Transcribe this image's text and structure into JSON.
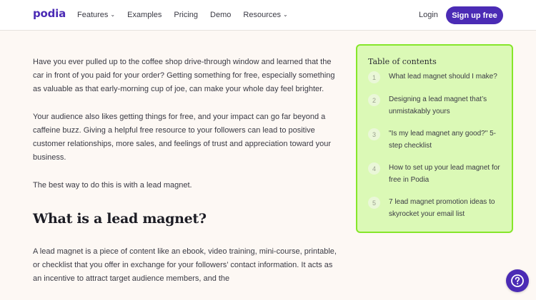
{
  "nav": {
    "logo": "podia",
    "links": [
      {
        "label": "Features",
        "dropdown": true
      },
      {
        "label": "Examples",
        "dropdown": false
      },
      {
        "label": "Pricing",
        "dropdown": false
      },
      {
        "label": "Demo",
        "dropdown": false
      },
      {
        "label": "Resources",
        "dropdown": true
      }
    ],
    "login": "Login",
    "signup": "Sign up free"
  },
  "article": {
    "paragraphs": [
      "Have you ever pulled up to the coffee shop drive-through window and learned that the car in front of you paid for your order? Getting something for free, especially something as valuable as that early-morning cup of joe, can make your whole day feel brighter.",
      "Your audience also likes getting things for free, and your impact can go far beyond a caffeine buzz. Giving a helpful free resource to your followers can lead to positive customer relationships, more sales, and feelings of trust and appreciation toward your business.",
      "The best way to do this is with a lead magnet."
    ],
    "heading": "What is a lead magnet?",
    "paragraph_after": "A lead magnet is a piece of content like an ebook, video training, mini-course, printable, or checklist that you offer in exchange for your followers’ contact information. It acts as an incentive to attract target audience members, and the"
  },
  "toc": {
    "title": "Table of contents",
    "items": [
      {
        "num": "1",
        "text": "What lead magnet should I make?"
      },
      {
        "num": "2",
        "text": "Designing a lead magnet that’s unmistakably yours"
      },
      {
        "num": "3",
        "text": "\"Is my lead magnet any good?\" 5-step checklist"
      },
      {
        "num": "4",
        "text": "How to set up your lead magnet for free in Podia"
      },
      {
        "num": "5",
        "text": "7 lead magnet promotion ideas to skyrocket your email list"
      }
    ]
  },
  "help": {
    "icon": "question-icon"
  },
  "colors": {
    "brand": "#4b2bb5",
    "toc_bg": "#dbf9b6",
    "toc_border": "#86e62a",
    "page_bg": "#fdf8f4"
  }
}
